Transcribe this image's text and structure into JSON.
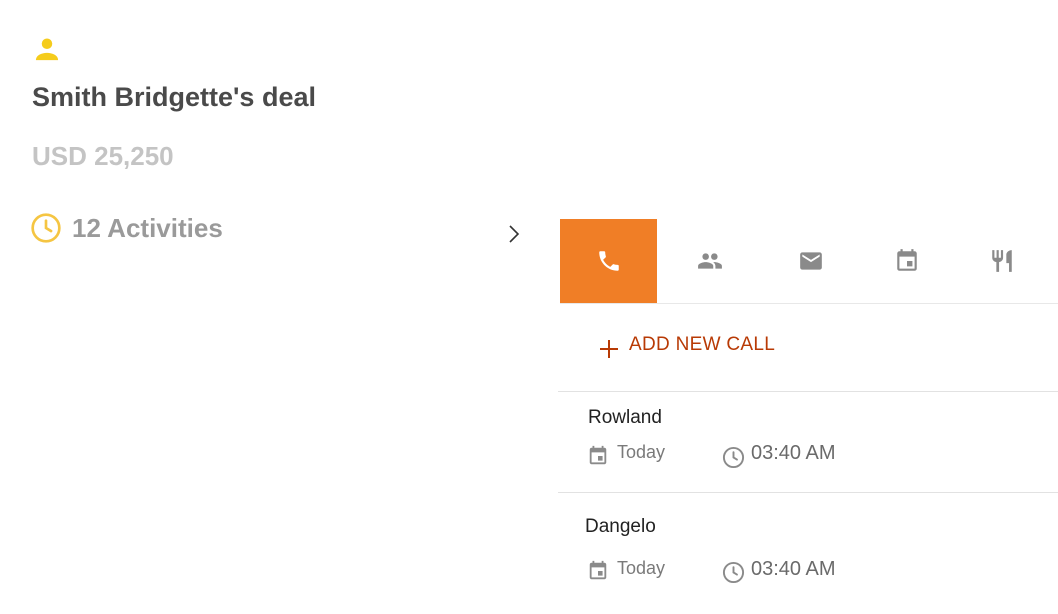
{
  "deal": {
    "title": "Smith Bridgette's deal",
    "amount": "USD 25,250",
    "activities_label": "12 Activities",
    "icon": "person-icon",
    "accent_color": "#f5cc1c"
  },
  "tabs": [
    {
      "name": "call",
      "icon": "phone-icon",
      "active": true
    },
    {
      "name": "meeting",
      "icon": "people-icon",
      "active": false
    },
    {
      "name": "email",
      "icon": "mail-icon",
      "active": false
    },
    {
      "name": "event",
      "icon": "calendar-icon",
      "active": false
    },
    {
      "name": "lunch",
      "icon": "restaurant-icon",
      "active": false
    }
  ],
  "tab_active_color": "#f07e26",
  "add_call_label": "ADD NEW CALL",
  "calls": [
    {
      "name": "Rowland",
      "date": "Today",
      "time": "03:40 AM"
    },
    {
      "name": "Dangelo",
      "date": "Today",
      "time": "03:40 AM"
    }
  ]
}
